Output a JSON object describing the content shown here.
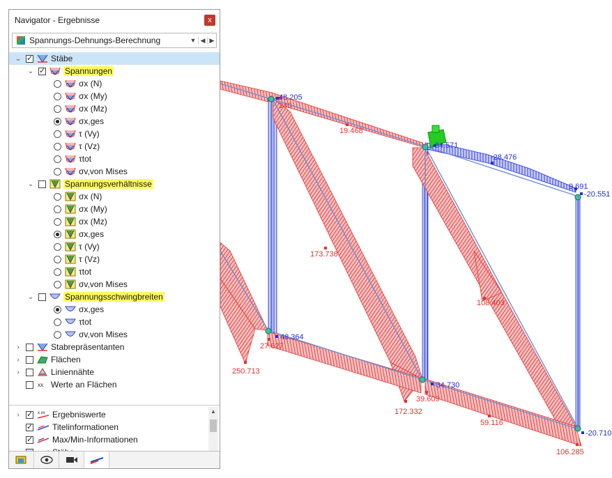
{
  "navigator": {
    "title": "Navigator - Ergebnisse",
    "close_label": "x",
    "combo_value": "Spannungs-Dehnungs-Berechnung",
    "tree": [
      {
        "label": "Stäbe",
        "type": "check",
        "checked": true,
        "expanded": true,
        "indent": 0,
        "selected": true,
        "icon": "member-stress-icon"
      },
      {
        "label": "Spannungen",
        "type": "check",
        "checked": true,
        "expanded": true,
        "indent": 1,
        "highlight": true,
        "icon": "stress-icon"
      },
      {
        "label": "σx (N)",
        "type": "radio",
        "checked": false,
        "indent": 2,
        "icon": "stress-icon"
      },
      {
        "label": "σx (My)",
        "type": "radio",
        "checked": false,
        "indent": 2,
        "icon": "stress-icon"
      },
      {
        "label": "σx (Mz)",
        "type": "radio",
        "checked": false,
        "indent": 2,
        "icon": "stress-icon"
      },
      {
        "label": "σx,ges",
        "type": "radio",
        "checked": true,
        "indent": 2,
        "icon": "stress-icon"
      },
      {
        "label": "τ (Vy)",
        "type": "radio",
        "checked": false,
        "indent": 2,
        "icon": "stress-icon"
      },
      {
        "label": "τ (Vz)",
        "type": "radio",
        "checked": false,
        "indent": 2,
        "icon": "stress-icon"
      },
      {
        "label": "τtot",
        "type": "radio",
        "checked": false,
        "indent": 2,
        "icon": "stress-icon"
      },
      {
        "label": "σv,von Mises",
        "type": "radio",
        "checked": false,
        "indent": 2,
        "icon": "stress-icon"
      },
      {
        "label": "Spannungsverhältnisse",
        "type": "check",
        "checked": false,
        "expanded": true,
        "indent": 1,
        "highlight": true,
        "icon": "ratio-icon"
      },
      {
        "label": "σx (N)",
        "type": "radio",
        "checked": false,
        "indent": 2,
        "icon": "ratio-icon"
      },
      {
        "label": "σx (My)",
        "type": "radio",
        "checked": false,
        "indent": 2,
        "icon": "ratio-icon"
      },
      {
        "label": "σx (Mz)",
        "type": "radio",
        "checked": false,
        "indent": 2,
        "icon": "ratio-icon"
      },
      {
        "label": "σx,ges",
        "type": "radio",
        "checked": true,
        "indent": 2,
        "icon": "ratio-icon"
      },
      {
        "label": "τ (Vy)",
        "type": "radio",
        "checked": false,
        "indent": 2,
        "icon": "ratio-icon"
      },
      {
        "label": "τ (Vz)",
        "type": "radio",
        "checked": false,
        "indent": 2,
        "icon": "ratio-icon"
      },
      {
        "label": "τtot",
        "type": "radio",
        "checked": false,
        "indent": 2,
        "icon": "ratio-icon"
      },
      {
        "label": "σv,von Mises",
        "type": "radio",
        "checked": false,
        "indent": 2,
        "icon": "ratio-icon"
      },
      {
        "label": "Spannungsschwingbreiten",
        "type": "check",
        "checked": false,
        "expanded": true,
        "indent": 1,
        "highlight": true,
        "icon": "range-icon"
      },
      {
        "label": "σx,ges",
        "type": "radio",
        "checked": true,
        "indent": 2,
        "icon": "range-icon"
      },
      {
        "label": "τtot",
        "type": "radio",
        "checked": false,
        "indent": 2,
        "icon": "range-icon"
      },
      {
        "label": "σv,von Mises",
        "type": "radio",
        "checked": false,
        "indent": 2,
        "icon": "range-icon"
      },
      {
        "label": "Stabrepräsentanten",
        "type": "check",
        "checked": false,
        "expanded": false,
        "indent": 0,
        "icon": "member-stress-icon"
      },
      {
        "label": "Flächen",
        "type": "check",
        "checked": false,
        "expanded": false,
        "indent": 0,
        "icon": "surface-icon"
      },
      {
        "label": "Liniennähte",
        "type": "check",
        "checked": false,
        "expanded": false,
        "indent": 0,
        "icon": "weld-icon"
      },
      {
        "label": "Werte an Flächen",
        "type": "check",
        "checked": false,
        "indent": 0,
        "icon": "values-icon"
      }
    ],
    "tree2": [
      {
        "label": "Ergebniswerte",
        "checked": true,
        "expandable": true,
        "icon": "result-values-icon"
      },
      {
        "label": "Titelinformationen",
        "checked": true,
        "expandable": false,
        "icon": "title-info-icon"
      },
      {
        "label": "Max/Min-Informationen",
        "checked": true,
        "expandable": false,
        "icon": "maxmin-icon"
      },
      {
        "label": "Stäbe",
        "checked": false,
        "expandable": true,
        "icon": "member-display-icon"
      }
    ],
    "tabs": [
      "data-tab",
      "view-tab",
      "camera-tab",
      "result-tab"
    ]
  },
  "model": {
    "labels_red": [
      "19.468",
      "173.738",
      "108.403",
      "27.627",
      "250.713",
      "172.332",
      "39.609",
      "59.116",
      "106.285",
      "140"
    ],
    "labels_blue": [
      "48.205",
      "-34.571",
      "-28.476",
      "9.691",
      "-20.551",
      "48.364",
      "-34.730",
      "-20.710"
    ]
  },
  "colors": {
    "stress_red": "#e83030",
    "stress_blue": "#2330d8",
    "highlight": "#fffb5c",
    "selection": "#cce4f7",
    "support_green": "#22cc22"
  }
}
